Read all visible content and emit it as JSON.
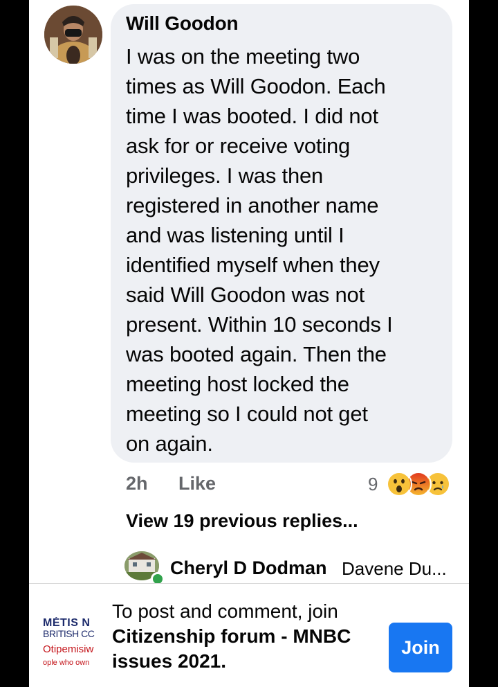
{
  "comment": {
    "author": "Will Goodon",
    "lines": [
      "I was on the meeting two",
      "times as Will Goodon. Each",
      "time I was booted. I did not",
      "ask for or receive voting",
      "privileges. I was then",
      "registered in another name",
      "and was listening until I",
      "identified myself when they",
      "said Will Goodon was not",
      "present. Within 10 seconds I",
      "was booted again. Then the",
      "meeting host locked the",
      "meeting so I could not get",
      "on again."
    ],
    "time": "2h",
    "like_label": "Like",
    "reaction_count": "9",
    "reactions": [
      "wow-reaction-icon",
      "angry-reaction-icon",
      "sad-reaction-icon"
    ]
  },
  "replies": {
    "view_previous_label": "View 19 previous replies...",
    "latest": {
      "author": "Cheryl D Dodman",
      "preview": "Davene Du..."
    }
  },
  "join_bar": {
    "line1": "To post and comment, join",
    "group_line1": "Citizenship forum - MNBC",
    "group_line2": "issues 2021.",
    "button_label": "Join",
    "logo": {
      "line1": "MÉTIS N",
      "line2": "BRITISH CC",
      "line3": "Otipemisiw",
      "line4": "ople who own"
    }
  },
  "colors": {
    "bubble": "#eef0f4",
    "secondary_text": "#65676b",
    "join_button": "#1877f2",
    "online_dot": "#31a24c"
  }
}
